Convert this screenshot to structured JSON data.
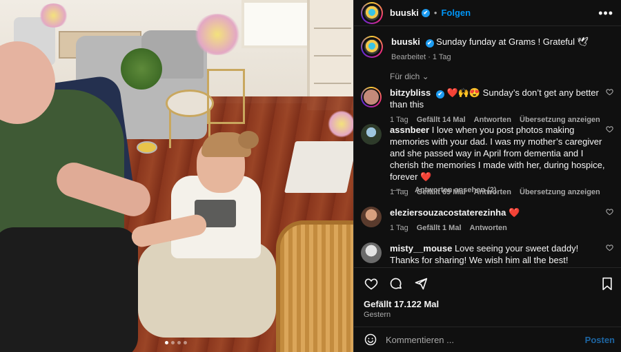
{
  "header": {
    "username": "buuski",
    "verified_mark": "✔",
    "separator": "•",
    "follow_label": "Folgen",
    "more_label": "•••"
  },
  "caption": {
    "username": "buuski",
    "text": "Sunday funday at Grams ! Grateful 🕊",
    "meta": "Bearbeitet · 1 Tag"
  },
  "for_you": "Für dich ⌄",
  "comments": [
    {
      "username": "bitzybliss",
      "text": "❤️🙌😍 Sunday’s don’t get any better than this",
      "time": "1 Tag",
      "likes": "Gefällt 14 Mal",
      "reply": "Antworten",
      "translate": "Übersetzung anzeigen"
    },
    {
      "username": "assnbeer",
      "text": "I love when you post photos making memories with your dad. I was my mother’s caregiver and she passed way in April from dementia and I cherish the memories I made with her, during hospice, forever ❤️",
      "time": "1 Tag",
      "likes": "Gefällt 69 Mal",
      "reply": "Antworten",
      "translate": "Übersetzung anzeigen",
      "view_replies": "Antworten ansehen (2)"
    },
    {
      "username": "eleziersouzacostaterezinha",
      "text": "❤️",
      "time": "1 Tag",
      "likes": "Gefällt 1 Mal",
      "reply": "Antworten"
    },
    {
      "username": "misty__mouse",
      "text": "Love seeing your sweet daddy! Thanks for sharing! We wish him all the best!"
    }
  ],
  "actions": {
    "likes": "Gefällt 17.122 Mal",
    "date": "Gestern"
  },
  "footer": {
    "placeholder": "Kommentieren ...",
    "post_label": "Posten"
  },
  "carousel": {
    "count": 4,
    "active_index": 0
  },
  "colors": {
    "accent": "#0095f6",
    "panel_bg": "#101010",
    "muted": "#a8a8a8",
    "verified": "#1d9bf0"
  },
  "icons": [
    "heart-icon",
    "comment-icon",
    "share-icon",
    "bookmark-icon",
    "emoji-icon",
    "more-icon",
    "verified-icon"
  ]
}
